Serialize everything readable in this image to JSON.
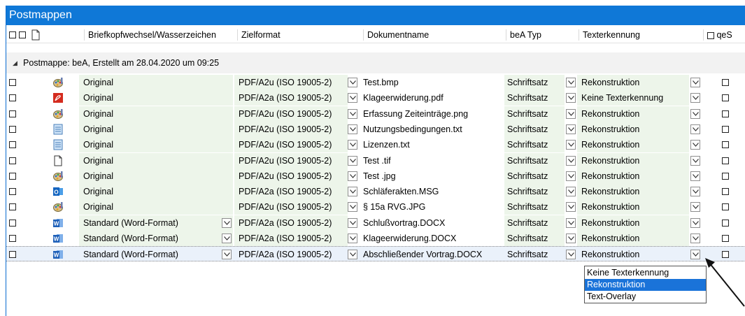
{
  "window": {
    "title": "Postmappen"
  },
  "columns": {
    "briefkopf": "Briefkopfwechsel/Wasserzeichen",
    "zielformat": "Zielformat",
    "dokumentname": "Dokumentname",
    "bea_typ": "beA Typ",
    "texterkennung": "Texterkennung",
    "qes": "qeS"
  },
  "group": {
    "label": "Postmappe: beA, Erstellt am 28.04.2020 um 09:25"
  },
  "rows": [
    {
      "icon": "image-icon",
      "briefkopf": "Original",
      "zielformat": "PDF/A2u (ISO 19005-2)",
      "dokumentname": "Test.bmp",
      "bea_typ": "Schriftsatz",
      "texterkennung": "Rekonstruktion"
    },
    {
      "icon": "pdf-icon",
      "briefkopf": "Original",
      "zielformat": "PDF/A2a (ISO 19005-2)",
      "dokumentname": "Klageerwiderung.pdf",
      "bea_typ": "Schriftsatz",
      "texterkennung": "Keine Texterkennung"
    },
    {
      "icon": "image-icon",
      "briefkopf": "Original",
      "zielformat": "PDF/A2u (ISO 19005-2)",
      "dokumentname": "Erfassung Zeiteinträge.png",
      "bea_typ": "Schriftsatz",
      "texterkennung": "Rekonstruktion"
    },
    {
      "icon": "text-file-icon",
      "briefkopf": "Original",
      "zielformat": "PDF/A2u (ISO 19005-2)",
      "dokumentname": "Nutzungsbedingungen.txt",
      "bea_typ": "Schriftsatz",
      "texterkennung": "Rekonstruktion"
    },
    {
      "icon": "text-file-icon",
      "briefkopf": "Original",
      "zielformat": "PDF/A2u (ISO 19005-2)",
      "dokumentname": "Lizenzen.txt",
      "bea_typ": "Schriftsatz",
      "texterkennung": "Rekonstruktion"
    },
    {
      "icon": "blank-file-icon",
      "briefkopf": "Original",
      "zielformat": "PDF/A2u (ISO 19005-2)",
      "dokumentname": "Test .tif",
      "bea_typ": "Schriftsatz",
      "texterkennung": "Rekonstruktion"
    },
    {
      "icon": "image-icon",
      "briefkopf": "Original",
      "zielformat": "PDF/A2u (ISO 19005-2)",
      "dokumentname": "Test .jpg",
      "bea_typ": "Schriftsatz",
      "texterkennung": "Rekonstruktion"
    },
    {
      "icon": "outlook-icon",
      "briefkopf": "Original",
      "zielformat": "PDF/A2a (ISO 19005-2)",
      "dokumentname": "Schläferakten.MSG",
      "bea_typ": "Schriftsatz",
      "texterkennung": "Rekonstruktion"
    },
    {
      "icon": "image-icon",
      "briefkopf": "Original",
      "zielformat": "PDF/A2u (ISO 19005-2)",
      "dokumentname": "§ 15a RVG.JPG",
      "bea_typ": "Schriftsatz",
      "texterkennung": "Rekonstruktion"
    },
    {
      "icon": "word-icon",
      "briefkopf": "Standard (Word-Format)",
      "zielformat": "PDF/A2a (ISO 19005-2)",
      "dokumentname": "Schlußvortrag.DOCX",
      "bea_typ": "Schriftsatz",
      "texterkennung": "Rekonstruktion"
    },
    {
      "icon": "word-icon",
      "briefkopf": "Standard (Word-Format)",
      "zielformat": "PDF/A2a (ISO 19005-2)",
      "dokumentname": "Klageerwiderung.DOCX",
      "bea_typ": "Schriftsatz",
      "texterkennung": "Rekonstruktion"
    },
    {
      "icon": "word-icon",
      "briefkopf": "Standard (Word-Format)",
      "zielformat": "PDF/A2a (ISO 19005-2)",
      "dokumentname": "Abschließender Vortrag.DOCX",
      "bea_typ": "Schriftsatz",
      "texterkennung": "Rekonstruktion"
    }
  ],
  "dropdown": {
    "options": [
      "Keine Texterkennung",
      "Rekonstruktion",
      "Text-Overlay"
    ],
    "selected": "Rekonstruktion"
  },
  "colors": {
    "titlebar": "#0f78d7",
    "highlight": "#1a73d9",
    "row_green": "#edf5ea"
  }
}
